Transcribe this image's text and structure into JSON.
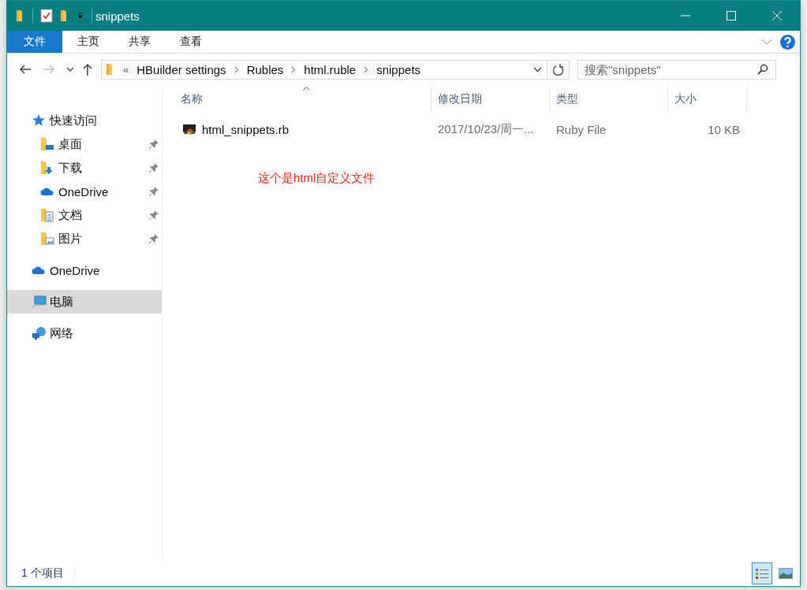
{
  "window": {
    "title": "snippets"
  },
  "ribbon_tabs": [
    {
      "label": "文件",
      "selected": true
    },
    {
      "label": "主页",
      "selected": false
    },
    {
      "label": "共享",
      "selected": false
    },
    {
      "label": "查看",
      "selected": false
    }
  ],
  "address": {
    "overflow": "«",
    "segments": [
      "HBuilder settings",
      "Rubles",
      "html.ruble",
      "snippets"
    ]
  },
  "search": {
    "placeholder": "搜索\"snippets\""
  },
  "sidebar": [
    {
      "label": "快速访问",
      "kind": "star",
      "selected": false,
      "children": [
        {
          "label": "桌面",
          "kind": "desktop",
          "pinned": true,
          "selected": false
        },
        {
          "label": "下载",
          "kind": "downloads",
          "pinned": true,
          "selected": false
        },
        {
          "label": "OneDrive",
          "kind": "cloud",
          "pinned": true,
          "selected": false
        },
        {
          "label": "文档",
          "kind": "documents",
          "pinned": true,
          "selected": false
        },
        {
          "label": "图片",
          "kind": "pictures",
          "pinned": true,
          "selected": false
        }
      ]
    },
    {
      "label": "OneDrive",
      "kind": "cloud",
      "selected": false
    },
    {
      "label": "电脑",
      "kind": "computer",
      "selected": true
    },
    {
      "label": "网络",
      "kind": "network",
      "selected": false
    }
  ],
  "table": {
    "columns": [
      {
        "label": "名称",
        "sorted": true
      },
      {
        "label": "修改日期",
        "sorted": false
      },
      {
        "label": "类型",
        "sorted": false
      },
      {
        "label": "大小",
        "sorted": false
      }
    ],
    "rows": [
      {
        "name": "html_snippets.rb",
        "modified": "2017/10/23/周一...",
        "type": "Ruby File",
        "size": "10 KB",
        "selected": false
      }
    ]
  },
  "annotation": "这个是html自定义文件",
  "status_bar": {
    "text": "1 个项目",
    "views": [
      {
        "kind": "details",
        "selected": true
      },
      {
        "kind": "large-icons",
        "selected": false
      }
    ]
  }
}
